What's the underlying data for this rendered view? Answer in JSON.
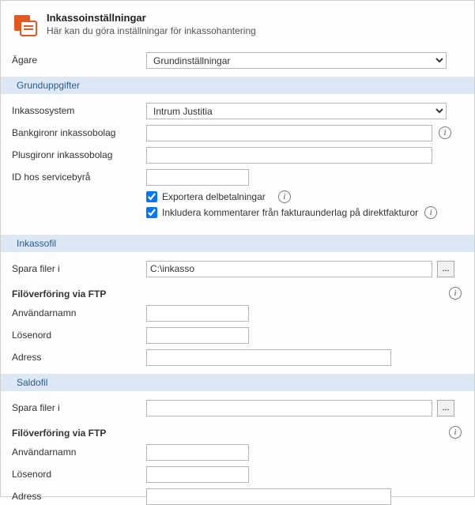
{
  "header": {
    "title": "Inkassoinställningar",
    "subtitle": "Här kan du göra inställningar för inkassohantering"
  },
  "owner": {
    "label": "Ägare",
    "value": "Grundinställningar"
  },
  "sections": {
    "basic": {
      "title": "Grunduppgifter",
      "system": {
        "label": "Inkassosystem",
        "value": "Intrum Justitia"
      },
      "bankgiro": {
        "label": "Bankgironr inkassobolag",
        "value": ""
      },
      "plusgiro": {
        "label": "Plusgironr inkassobolag",
        "value": ""
      },
      "serviceid": {
        "label": "ID hos servicebyrå",
        "value": ""
      },
      "export_partial": {
        "label": "Exportera delbetalningar",
        "checked": true
      },
      "include_comments": {
        "label": "Inkludera kommentarer från fakturaunderlag på direktfakturor",
        "checked": true
      }
    },
    "inkassofil": {
      "title": "Inkassofil",
      "save_in": {
        "label": "Spara filer i",
        "value": "C:\\inkasso"
      },
      "ftp_title": "Filöverföring via FTP",
      "ftp": {
        "user": {
          "label": "Användarnamn",
          "value": ""
        },
        "pass": {
          "label": "Lösenord",
          "value": ""
        },
        "addr": {
          "label": "Adress",
          "value": ""
        }
      },
      "browse": "..."
    },
    "saldofil": {
      "title": "Saldofil",
      "save_in": {
        "label": "Spara filer i",
        "value": ""
      },
      "ftp_title": "Filöverföring via FTP",
      "ftp": {
        "user": {
          "label": "Användarnamn",
          "value": ""
        },
        "pass": {
          "label": "Lösenord",
          "value": ""
        },
        "addr": {
          "label": "Adress",
          "value": ""
        }
      },
      "browse": "..."
    }
  },
  "icons": {
    "info_glyph": "i"
  }
}
